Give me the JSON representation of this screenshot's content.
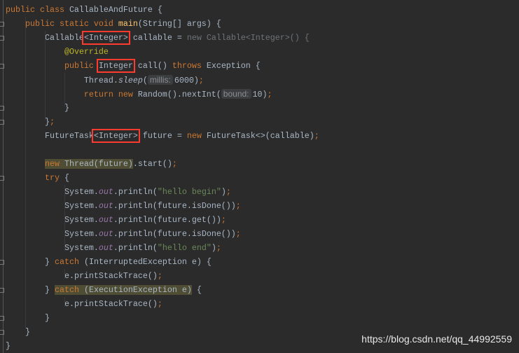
{
  "editor": {
    "colors": {
      "background": "#2b2b2b",
      "keyword": "#cc7832",
      "text": "#a9b7c6",
      "string": "#6a8759",
      "annotation": "#bbb529",
      "static_field": "#9876aa",
      "method_declaration": "#ffc66d",
      "highlight_box": "#ff3b30"
    },
    "lines": [
      {
        "indent": 0,
        "tokens": [
          [
            "k",
            "public class "
          ],
          [
            "t",
            "CallableAndFuture {"
          ]
        ]
      },
      {
        "indent": 1,
        "tokens": [
          [
            "k",
            "public static void "
          ],
          [
            "m",
            "main"
          ],
          [
            "t",
            "(String[] args) {"
          ]
        ]
      },
      {
        "indent": 2,
        "tokens": [
          [
            "t",
            "Callable"
          ],
          [
            "t",
            "<Integer>",
            "box"
          ],
          [
            "t",
            " callable = "
          ],
          [
            "d",
            "new Callable<Integer>() {"
          ]
        ]
      },
      {
        "indent": 3,
        "tokens": [
          [
            "a",
            "@Override"
          ]
        ]
      },
      {
        "indent": 3,
        "tokens": [
          [
            "k",
            "public "
          ],
          [
            "t",
            "Integer",
            "box"
          ],
          [
            "t",
            " call() "
          ],
          [
            "k",
            "throws "
          ],
          [
            "t",
            "Exception {"
          ]
        ]
      },
      {
        "indent": 4,
        "tokens": [
          [
            "t",
            "Thread."
          ],
          [
            "i",
            "sleep"
          ],
          [
            "t",
            "("
          ],
          [
            "h",
            "millis:"
          ],
          [
            "t",
            "6000)"
          ],
          [
            "k",
            ";"
          ]
        ]
      },
      {
        "indent": 4,
        "tokens": [
          [
            "k",
            "return new "
          ],
          [
            "t",
            "Random().nextInt("
          ],
          [
            "h",
            "bound:"
          ],
          [
            "t",
            "10)"
          ],
          [
            "k",
            ";"
          ]
        ]
      },
      {
        "indent": 3,
        "tokens": [
          [
            "t",
            "}"
          ]
        ]
      },
      {
        "indent": 2,
        "tokens": [
          [
            "t",
            "}"
          ],
          [
            "k",
            ";"
          ]
        ]
      },
      {
        "indent": 2,
        "tokens": [
          [
            "t",
            "FutureTask"
          ],
          [
            "t",
            "<Integer>",
            "box"
          ],
          [
            "t",
            " future = "
          ],
          [
            "k",
            "new "
          ],
          [
            "t",
            "FutureTask<>(callable)"
          ],
          [
            "k",
            ";"
          ]
        ]
      },
      {
        "indent": 0,
        "tokens": []
      },
      {
        "indent": 2,
        "tokens": [
          [
            "k",
            "new ",
            "hl"
          ],
          [
            "t",
            "Thread(future)",
            "hl"
          ],
          [
            "t",
            ".start()"
          ],
          [
            "k",
            ";"
          ]
        ]
      },
      {
        "indent": 2,
        "tokens": [
          [
            "k",
            "try "
          ],
          [
            "t",
            "{"
          ]
        ]
      },
      {
        "indent": 3,
        "tokens": [
          [
            "t",
            "System."
          ],
          [
            "f",
            "out"
          ],
          [
            "t",
            ".println("
          ],
          [
            "s",
            "\"hello begin\""
          ],
          [
            "t",
            ")"
          ],
          [
            "k",
            ";"
          ]
        ]
      },
      {
        "indent": 3,
        "tokens": [
          [
            "t",
            "System."
          ],
          [
            "f",
            "out"
          ],
          [
            "t",
            ".println(future.isDone())"
          ],
          [
            "k",
            ";"
          ]
        ]
      },
      {
        "indent": 3,
        "tokens": [
          [
            "t",
            "System."
          ],
          [
            "f",
            "out"
          ],
          [
            "t",
            ".println(future.get())"
          ],
          [
            "k",
            ";"
          ]
        ]
      },
      {
        "indent": 3,
        "tokens": [
          [
            "t",
            "System."
          ],
          [
            "f",
            "out"
          ],
          [
            "t",
            ".println(future.isDone())"
          ],
          [
            "k",
            ";"
          ]
        ]
      },
      {
        "indent": 3,
        "tokens": [
          [
            "t",
            "System."
          ],
          [
            "f",
            "out"
          ],
          [
            "t",
            ".println("
          ],
          [
            "s",
            "\"hello end\""
          ],
          [
            "t",
            ")"
          ],
          [
            "k",
            ";"
          ]
        ]
      },
      {
        "indent": 2,
        "tokens": [
          [
            "t",
            "} "
          ],
          [
            "k",
            "catch "
          ],
          [
            "t",
            "(InterruptedException e) {"
          ]
        ]
      },
      {
        "indent": 3,
        "tokens": [
          [
            "t",
            "e.printStackTrace()"
          ],
          [
            "k",
            ";"
          ]
        ]
      },
      {
        "indent": 2,
        "tokens": [
          [
            "t",
            "} "
          ],
          [
            "k",
            "catch ",
            "hl"
          ],
          [
            "t",
            "(ExecutionException e)",
            "hl"
          ],
          [
            "t",
            " {"
          ]
        ]
      },
      {
        "indent": 3,
        "tokens": [
          [
            "t",
            "e.printStackTrace()"
          ],
          [
            "k",
            ";"
          ]
        ]
      },
      {
        "indent": 2,
        "tokens": [
          [
            "t",
            "}"
          ]
        ]
      },
      {
        "indent": 1,
        "tokens": [
          [
            "t",
            "}"
          ]
        ]
      },
      {
        "indent": 0,
        "tokens": [
          [
            "t",
            "}"
          ]
        ]
      }
    ]
  },
  "watermark": "https://blog.csdn.net/qq_44992559"
}
